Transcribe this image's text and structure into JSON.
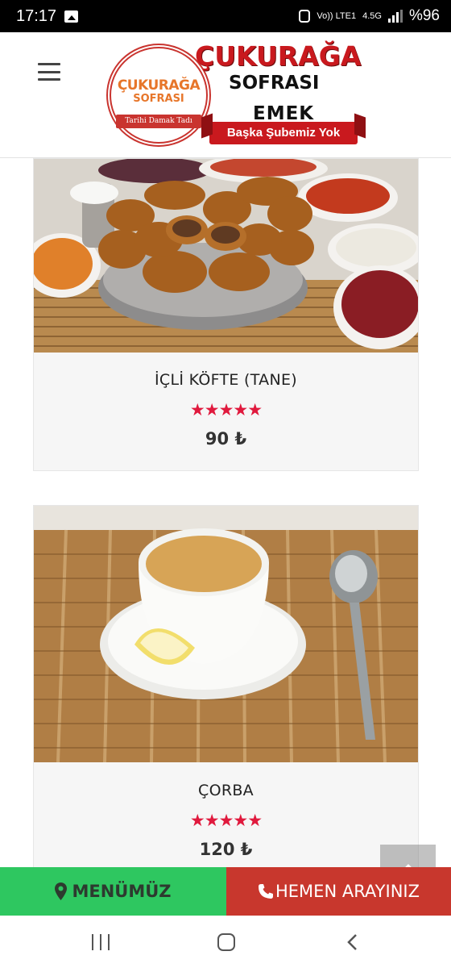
{
  "status_bar": {
    "time": "17:17",
    "network": "4.5G",
    "carrier_label": "Vo)) LTE1",
    "battery": "%96",
    "icons": [
      "image-icon",
      "alarm-icon",
      "signal-icon"
    ]
  },
  "header": {
    "menu_icon": "hamburger-icon",
    "logo": {
      "badge_title": "ÇUKURAĞA",
      "badge_sub": "SOFRASI",
      "badge_tagline": "Tarihi Damak Tadı",
      "name": "ÇUKURAĞA",
      "sub": "SOFRASI",
      "branch": "EMEK",
      "banner": "Başka Şubemiz Yok"
    }
  },
  "products": [
    {
      "title": "İÇLİ KÖFTE (TANE)",
      "rating": 5,
      "stars": "★★★★★",
      "price": "90 ₺"
    },
    {
      "title": "ÇORBA",
      "rating": 5,
      "stars": "★★★★★",
      "price": "120 ₺"
    }
  ],
  "action_bar": {
    "menu_label": "MENÜMÜZ",
    "menu_icon": "map-pin-icon",
    "call_label": "HEMEN ARAYINIZ",
    "call_icon": "phone-icon"
  },
  "colors": {
    "accent_red": "#e0193d",
    "menu_green": "#2ec760",
    "call_red": "#c8372d"
  }
}
